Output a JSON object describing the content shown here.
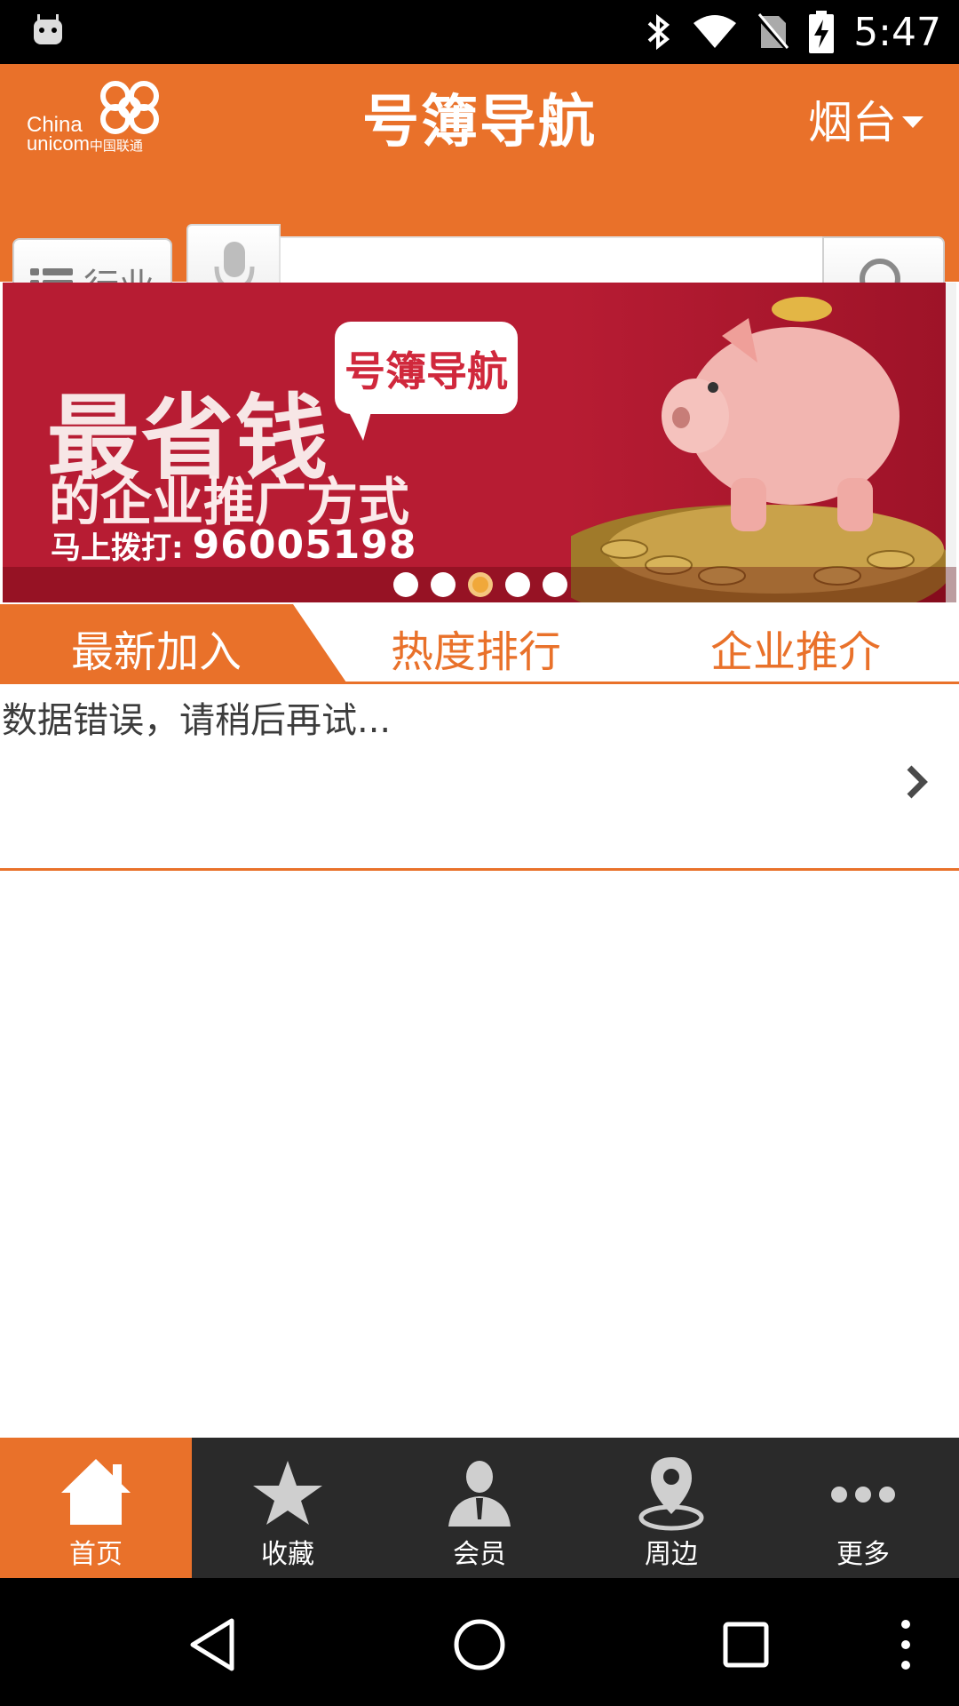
{
  "status_bar": {
    "time": "5:47",
    "icons": [
      "android-debug-icon",
      "bluetooth-icon",
      "wifi-icon",
      "no-sim-icon",
      "battery-charging-icon"
    ]
  },
  "header": {
    "logo_line1": "China",
    "logo_line2": "unicom",
    "logo_line2_cn": "中国联通",
    "brand": "号簿导航",
    "city": "烟台"
  },
  "search": {
    "industry_label": "行业",
    "placeholder": "",
    "value": ""
  },
  "banner": {
    "bubble_text": "号簿导航",
    "headline": "最省钱",
    "subline": "的企业推广方式",
    "phone_label": "马上拨打:",
    "phone_number": "96005198",
    "dot_count": 5,
    "active_dot_index": 2
  },
  "tabs": [
    {
      "label": "最新加入",
      "active": true
    },
    {
      "label": "热度排行",
      "active": false
    },
    {
      "label": "企业推介",
      "active": false
    }
  ],
  "list": {
    "message": "数据错误，请稍后再试..."
  },
  "bottom_nav": [
    {
      "label": "首页",
      "icon": "home-icon",
      "active": true
    },
    {
      "label": "收藏",
      "icon": "star-icon",
      "active": false
    },
    {
      "label": "会员",
      "icon": "member-icon",
      "active": false
    },
    {
      "label": "周边",
      "icon": "location-pin-icon",
      "active": false
    },
    {
      "label": "更多",
      "icon": "more-dots-icon",
      "active": false
    }
  ],
  "colors": {
    "accent": "#e9712a",
    "nav_bg": "#2a2a2a",
    "banner_red": "#b71c33"
  }
}
